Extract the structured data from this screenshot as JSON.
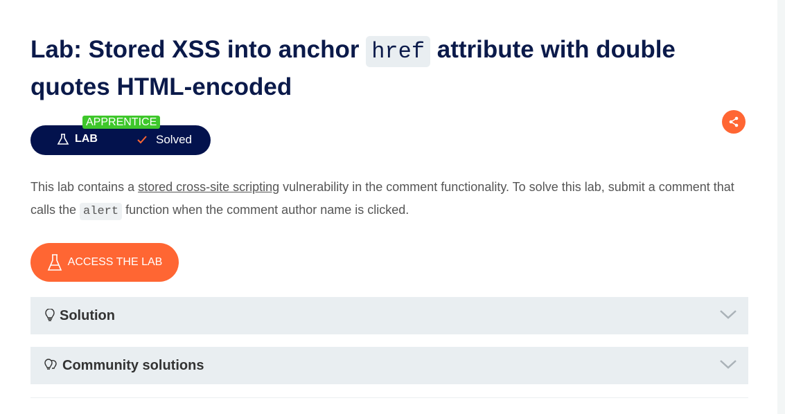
{
  "title_pre": "Lab: Stored XSS into anchor ",
  "title_code": "href",
  "title_post": " attribute with double quotes HTML-encoded",
  "badge": {
    "tier": "APPRENTICE",
    "lab": "LAB",
    "status": "Solved"
  },
  "description": {
    "p1": "This lab contains a ",
    "link": "stored cross-site scripting",
    "p2": " vulnerability in the comment functionality. To solve this lab, submit a comment that calls the ",
    "code": "alert",
    "p3": " function when the comment author name is clicked."
  },
  "access_button": "ACCESS THE LAB",
  "accordions": [
    {
      "label": "Solution",
      "icon": "lightbulb-icon"
    },
    {
      "label": "Community solutions",
      "icon": "lightbulbs-icon"
    }
  ],
  "colors": {
    "accent": "#ff6633",
    "navy": "#03124d",
    "apprentice": "#3ec72b"
  }
}
